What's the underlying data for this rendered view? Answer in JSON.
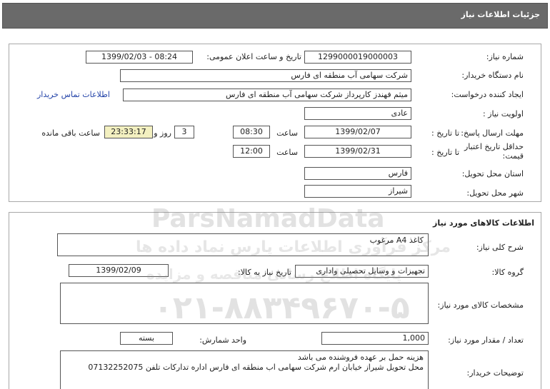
{
  "page": {
    "title": "جزئیات اطلاعات نیاز"
  },
  "need": {
    "number_label": "شماره نیاز:",
    "number": "1299000019000003",
    "announce_label": "تاریخ و ساعت اعلان عمومی:",
    "announce": "1399/02/03 - 08:24",
    "buyer_label": "نام دستگاه خریدار:",
    "buyer": "شرکت سهامی آب منطقه ای فارس",
    "creator_label": "ایجاد کننده درخواست:",
    "creator": "میثم فهندز کارپرداز شرکت سهامی آب منطقه ای فارس",
    "contact_link": "اطلاعات تماس خریدار",
    "priority_label": "اولویت نیاز :",
    "priority": "عادی",
    "deadline_label": "مهلت ارسال پاسخ:",
    "to_date_label": "تا تاریخ :",
    "deadline_date": "1399/02/07",
    "time_label": "ساعت",
    "deadline_time": "08:30",
    "days_value": "3",
    "days_label": "روز و",
    "remaining_time": "23:33:17",
    "remaining_label": "ساعت باقی مانده",
    "validity_label_1": "حداقل تاریخ اعتبار",
    "validity_label_2": "قیمت:",
    "validity_date": "1399/02/31",
    "validity_time": "12:00",
    "province_label": "استان محل تحویل:",
    "province": "فارس",
    "city_label": "شهر محل تحویل:",
    "city": "شیراز"
  },
  "goods": {
    "section_title": "اطلاعات کالاهای مورد نیاز",
    "desc_label": "شرح کلی نیاز:",
    "desc": "کاغذ A4 مرغوب",
    "group_label": "گروه کالا:",
    "group": "تجهیزات و وسایل تحصیلی واداری",
    "need_date_label": "تاریخ نیاز به کالا:",
    "need_date": "1399/02/09",
    "specs_label": "مشخصات کالای مورد نیاز:",
    "specs": "",
    "qty_label": "تعداد / مقدار مورد نیاز:",
    "qty": "1,000",
    "unit_label": "واحد شمارش:",
    "unit": "بسته",
    "notes_label": "توضیحات خریدار:",
    "notes_line1": "هزینه حمل بر عهده فروشنده می باشد",
    "notes_line2": "محل تحویل شیراز خیابان ارم شرکت سهامی اب منطقه ای فارس اداره تدارکات تلفن 07132252075"
  },
  "watermark": {
    "brand": "ParsNamadData",
    "tagline": "مرکز فرآوری اطلاعات پارس نماد داده ها",
    "subtitle": "پایگاه اطلاع رسانی مناقصه و مزایده",
    "phone": "۰۲۱-۸۸۳۴۹۶۷۰-۵"
  }
}
